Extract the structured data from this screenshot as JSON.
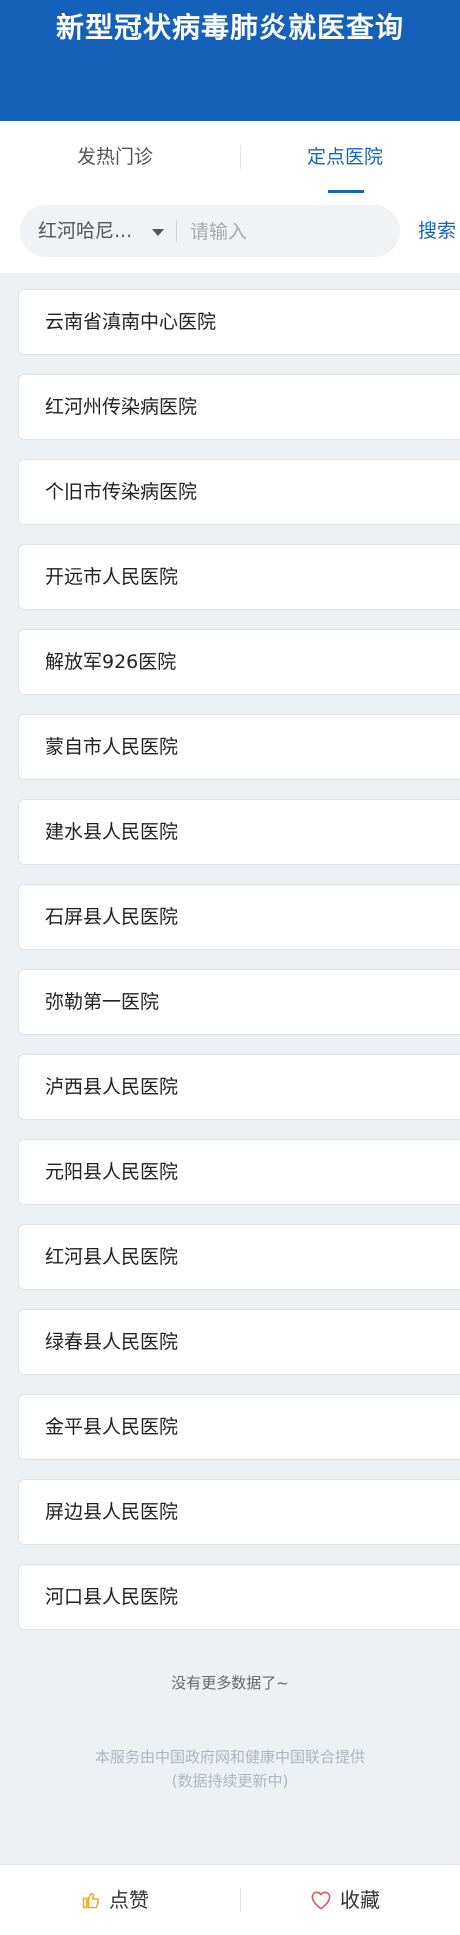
{
  "header": {
    "title": "新型冠状病毒肺炎就医查询"
  },
  "tabs": [
    {
      "label": "发热门诊",
      "active": false
    },
    {
      "label": "定点医院",
      "active": true
    }
  ],
  "search": {
    "region": "红河哈尼...",
    "placeholder": "请输入",
    "button_label": "搜索"
  },
  "hospitals": [
    "云南省滇南中心医院",
    "红河州传染病医院",
    "个旧市传染病医院",
    "开远市人民医院",
    "解放军926医院",
    "蒙自市人民医院",
    "建水县人民医院",
    "石屏县人民医院",
    "弥勒第一医院",
    "泸西县人民医院",
    "元阳县人民医院",
    "红河县人民医院",
    "绿春县人民医院",
    "金平县人民医院",
    "屏边县人民医院",
    "河口县人民医院"
  ],
  "list_end": "没有更多数据了~",
  "footer_note": {
    "line1": "本服务由中国政府网和健康中国联合提供",
    "line2": "(数据持续更新中)"
  },
  "bottom_bar": {
    "like_label": "点赞",
    "favorite_label": "收藏",
    "like_icon": "thumbs-up-icon",
    "favorite_icon": "heart-icon"
  },
  "colors": {
    "header_bg": "#1560b8",
    "accent": "#1565c0",
    "like_icon": "#f5a623",
    "favorite_icon": "#e05a5a"
  }
}
